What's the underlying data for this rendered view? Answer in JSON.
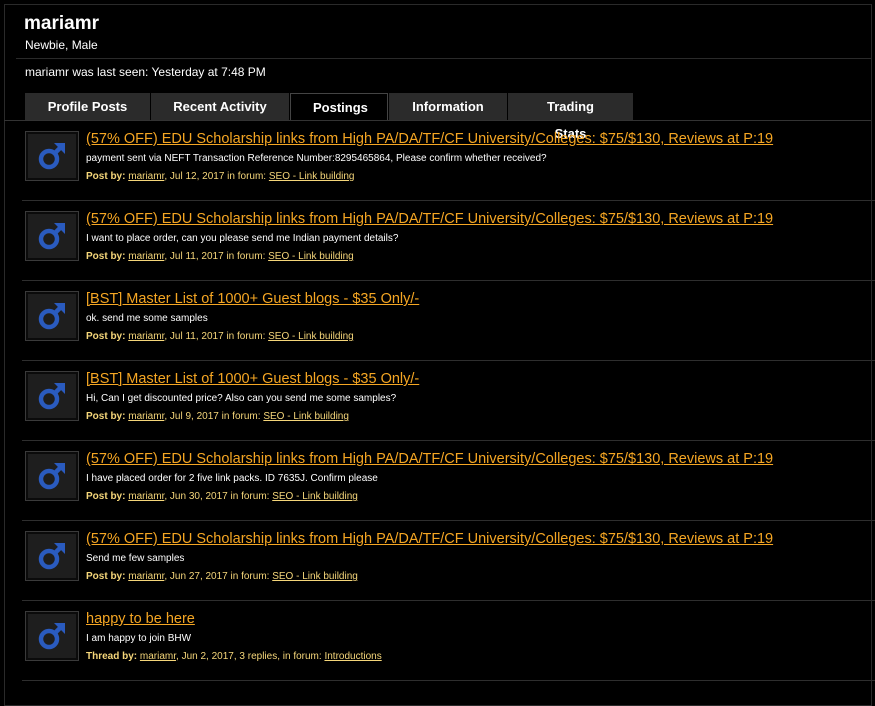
{
  "profile": {
    "username": "mariamr",
    "title": "Newbie, Male",
    "last_seen": "mariamr was last seen: Yesterday at 7:48 PM"
  },
  "tabs": [
    {
      "label": "Profile Posts",
      "active": false
    },
    {
      "label": "Recent Activity",
      "active": false
    },
    {
      "label": "Postings",
      "active": true
    },
    {
      "label": "Information",
      "active": false
    },
    {
      "label": "Trading Stats",
      "active": false
    }
  ],
  "colors": {
    "title_link": "#f5a623",
    "meta_text": "#f5d67a",
    "avatar_icon": "#2a5bbf"
  },
  "posts": [
    {
      "title": "(57% OFF) EDU Scholarship links from High PA/DA/TF/CF University/Colleges: $75/$130, Reviews at P:19",
      "excerpt": "payment sent via NEFT Transaction Reference Number:8295465864, Please confirm whether received?",
      "meta_label": "Post by:",
      "author": "mariamr",
      "meta_mid": ", Jul 12, 2017 in forum:",
      "forum": "SEO - Link building"
    },
    {
      "title": "(57% OFF) EDU Scholarship links from High PA/DA/TF/CF University/Colleges: $75/$130, Reviews at P:19",
      "excerpt": "I want to place order, can you please send me Indian payment details?",
      "meta_label": "Post by:",
      "author": "mariamr",
      "meta_mid": ", Jul 11, 2017 in forum:",
      "forum": "SEO - Link building"
    },
    {
      "title": "[BST] Master List of 1000+ Guest blogs - $35 Only/-",
      "excerpt": "ok. send me some samples",
      "meta_label": "Post by:",
      "author": "mariamr",
      "meta_mid": ", Jul 11, 2017 in forum:",
      "forum": "SEO - Link building"
    },
    {
      "title": "[BST] Master List of 1000+ Guest blogs - $35 Only/-",
      "excerpt": "Hi, Can I get discounted price? Also can you send me some samples?",
      "meta_label": "Post by:",
      "author": "mariamr",
      "meta_mid": ", Jul 9, 2017 in forum:",
      "forum": "SEO - Link building"
    },
    {
      "title": "(57% OFF) EDU Scholarship links from High PA/DA/TF/CF University/Colleges: $75/$130, Reviews at P:19",
      "excerpt": "I have placed order for 2 five link packs. ID 7635J. Confirm please",
      "meta_label": "Post by:",
      "author": "mariamr",
      "meta_mid": ", Jun 30, 2017 in forum:",
      "forum": "SEO - Link building"
    },
    {
      "title": "(57% OFF) EDU Scholarship links from High PA/DA/TF/CF University/Colleges: $75/$130, Reviews at P:19",
      "excerpt": "Send me few samples",
      "meta_label": "Post by:",
      "author": "mariamr",
      "meta_mid": ", Jun 27, 2017 in forum:",
      "forum": "SEO - Link building"
    },
    {
      "title": "happy to be here",
      "excerpt": "I am happy to join BHW",
      "meta_label": "Thread by:",
      "author": "mariamr",
      "meta_mid": ", Jun 2, 2017, 3 replies, in forum:",
      "forum": "Introductions"
    }
  ]
}
